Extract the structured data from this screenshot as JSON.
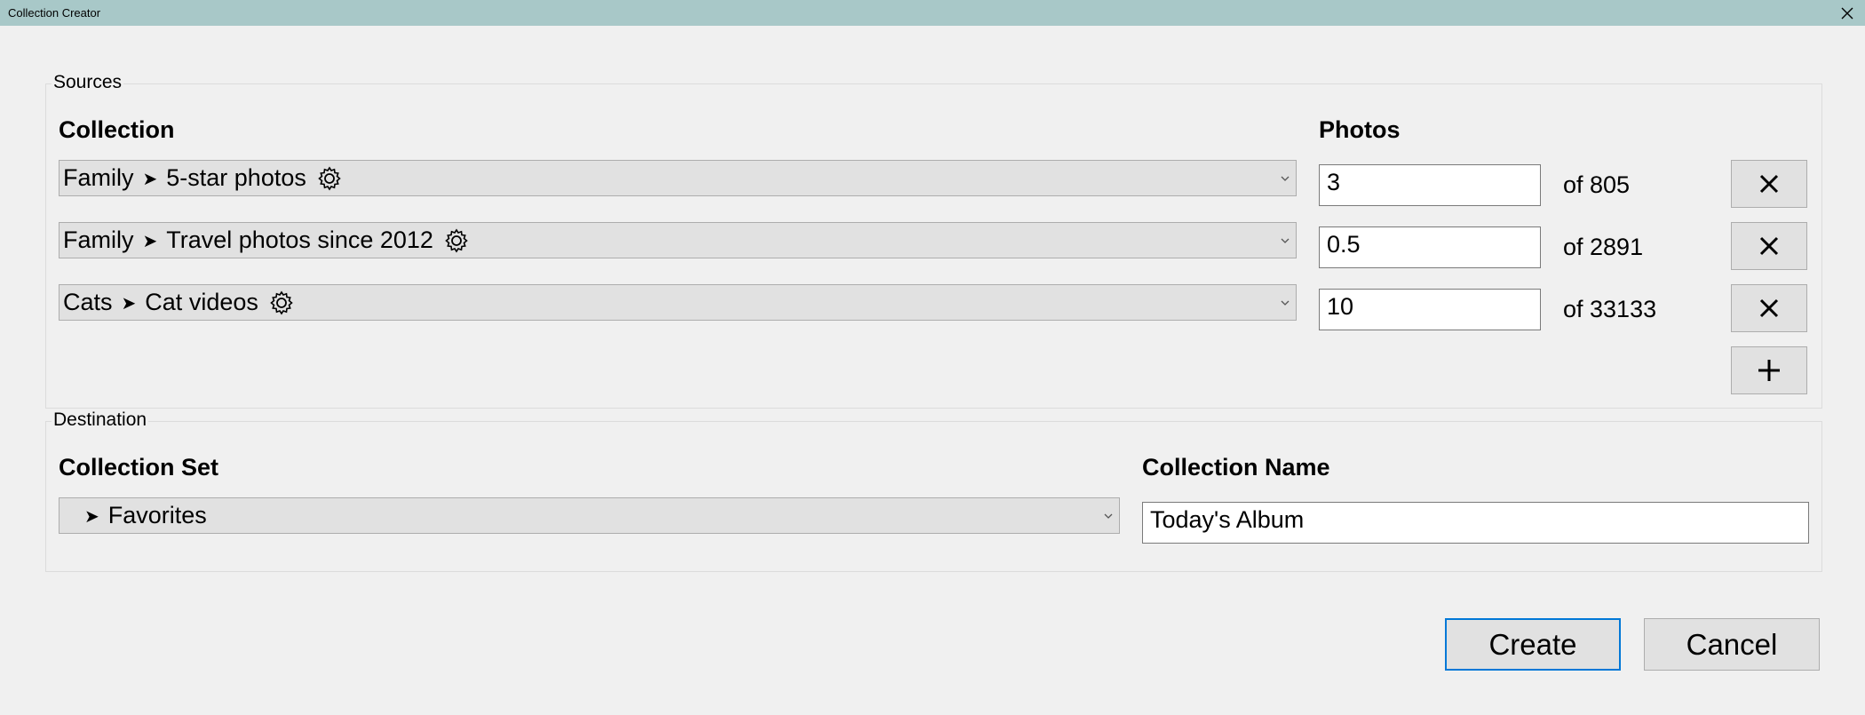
{
  "window": {
    "title": "Collection Creator",
    "close_icon": "close-icon"
  },
  "sources": {
    "label": "Sources",
    "collection_header": "Collection",
    "photos_header": "Photos",
    "rows": [
      {
        "parent": "Family",
        "name": "5-star photos",
        "photos": "3",
        "of_total": "of 805"
      },
      {
        "parent": "Family",
        "name": "Travel photos since 2012",
        "photos": "0.5",
        "of_total": "of 2891"
      },
      {
        "parent": "Cats",
        "name": "Cat videos",
        "photos": "10",
        "of_total": "of 33133"
      }
    ],
    "separator_glyph": "➤",
    "add_icon": "plus-icon",
    "remove_icon": "close-icon"
  },
  "destination": {
    "label": "Destination",
    "set_header": "Collection Set",
    "set_value": "Favorites",
    "set_glyph": "➤",
    "name_header": "Collection Name",
    "name_value": "Today's Album"
  },
  "buttons": {
    "create": "Create",
    "cancel": "Cancel"
  }
}
